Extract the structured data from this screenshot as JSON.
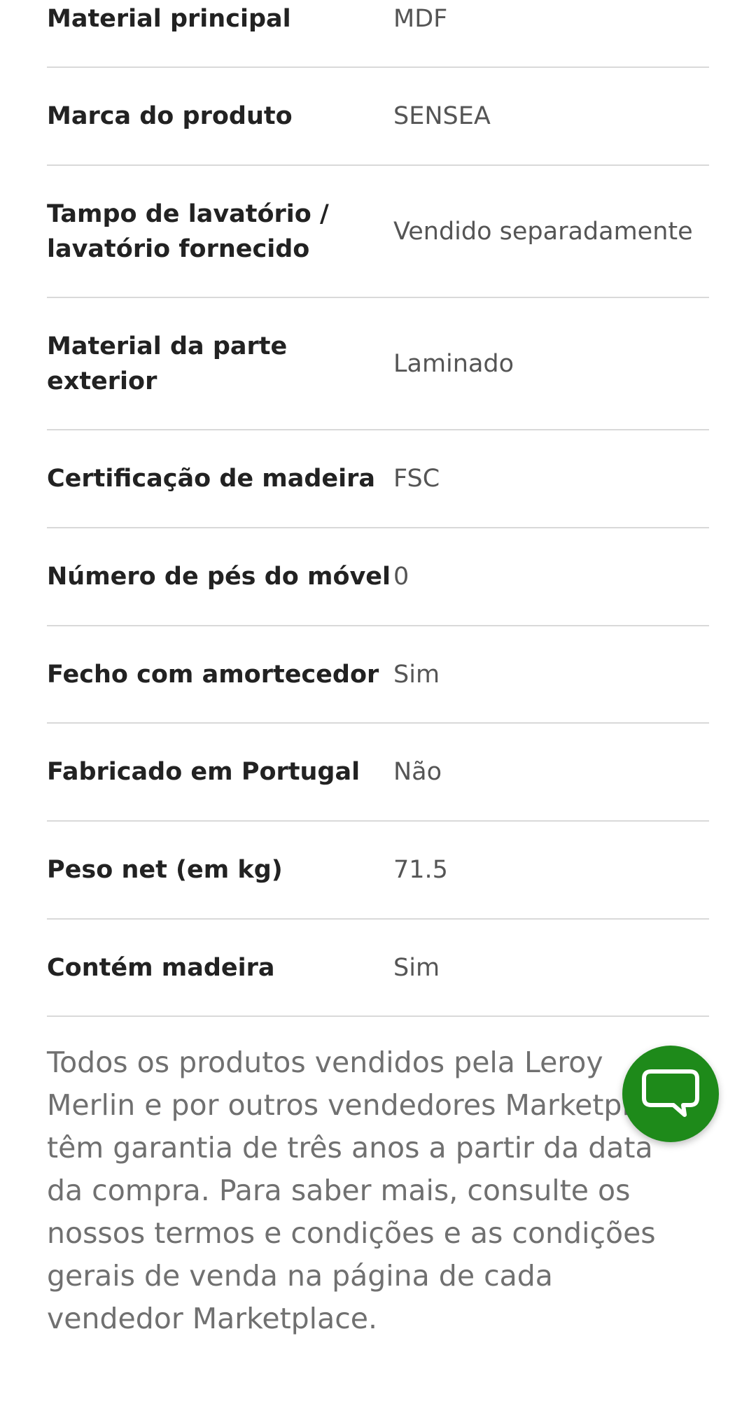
{
  "specs": [
    {
      "label": "Material principal",
      "value": "MDF"
    },
    {
      "label": "Marca do produto",
      "value": "SENSEA"
    },
    {
      "label": "Tampo de lavatório / lavatório fornecido",
      "value": "Vendido separadamente"
    },
    {
      "label": "Material da parte exterior",
      "value": "Laminado"
    },
    {
      "label": "Certificação de madeira",
      "value": "FSC"
    },
    {
      "label": "Número de pés do móvel",
      "value": "0"
    },
    {
      "label": "Fecho com amortecedor",
      "value": "Sim"
    },
    {
      "label": "Fabricado em Portugal",
      "value": "Não"
    },
    {
      "label": "Peso net (em kg)",
      "value": "71.5"
    },
    {
      "label": "Contém madeira",
      "value": "Sim"
    }
  ],
  "warranty_note": "Todos os produtos vendidos pela Leroy Merlin e por outros vendedores Marketplace têm garantia de três anos a partir da data da compra. Para saber mais, consulte os nossos termos e condições e as condições gerais de venda na página de cada vendedor Marketplace.",
  "chat_button": {
    "icon": "chat-bubble-icon",
    "color": "#1e8a1a"
  }
}
